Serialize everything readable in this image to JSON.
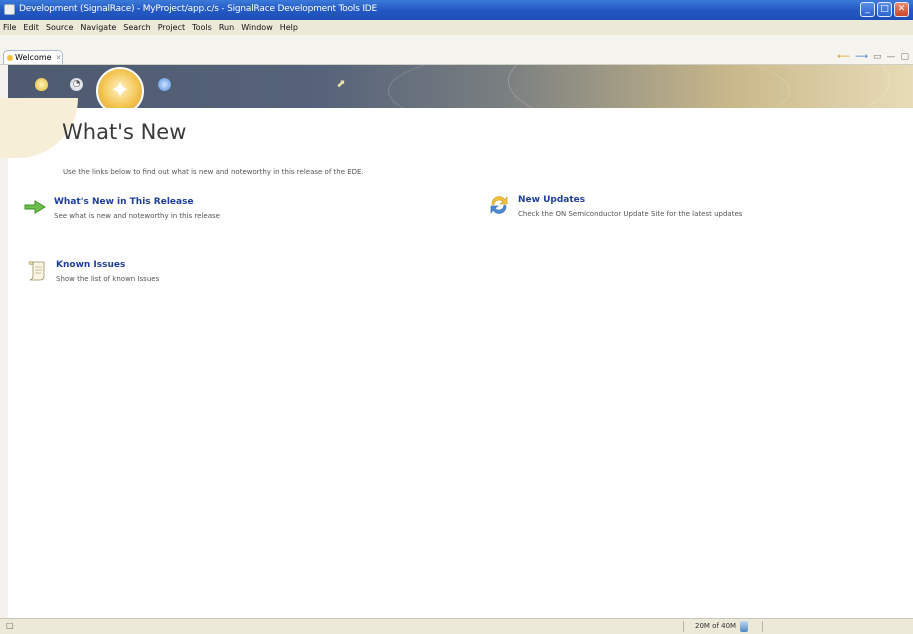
{
  "window": {
    "title": "Development (SignalRace) - MyProject/app.c/s - SignalRace Development Tools IDE",
    "controls": {
      "minimize": "_",
      "maximize": "□",
      "close": "✕"
    }
  },
  "menu": [
    "File",
    "Edit",
    "Source",
    "Navigate",
    "Search",
    "Project",
    "Tools",
    "Run",
    "Window",
    "Help"
  ],
  "tab": {
    "label": "Welcome",
    "close": "✕"
  },
  "view_tools": [
    "⟵",
    "⟶",
    "▭",
    "—",
    "▢"
  ],
  "banner": {
    "nav": [
      {
        "name": "overview",
        "glyph": "💡"
      },
      {
        "name": "tutorials",
        "glyph": "◔"
      },
      {
        "name": "whats-new",
        "glyph": "✦"
      },
      {
        "name": "samples",
        "glyph": "◉"
      },
      {
        "name": "workbench",
        "glyph": "⬈"
      }
    ]
  },
  "page": {
    "title": "What's New",
    "intro": "Use the links below to find out what is new and noteworthy in this release of the EDE.",
    "links": [
      {
        "icon": "green-arrow-icon",
        "title": "What's New in This Release",
        "description": "See what is new and noteworthy in this release"
      },
      {
        "icon": "update-arrows-icon",
        "title": "New Updates",
        "description": "Check the ON Semiconductor Update Site for the latest updates"
      },
      {
        "icon": "scroll-document-icon",
        "title": "Known Issues",
        "description": "Show the list of known Issues"
      }
    ]
  },
  "status": {
    "left": "□",
    "heap": "20M of 40M"
  },
  "colors": {
    "titlebar": "#2358c4",
    "link": "#1f3f9a",
    "accent_gold": "#f3c450"
  }
}
